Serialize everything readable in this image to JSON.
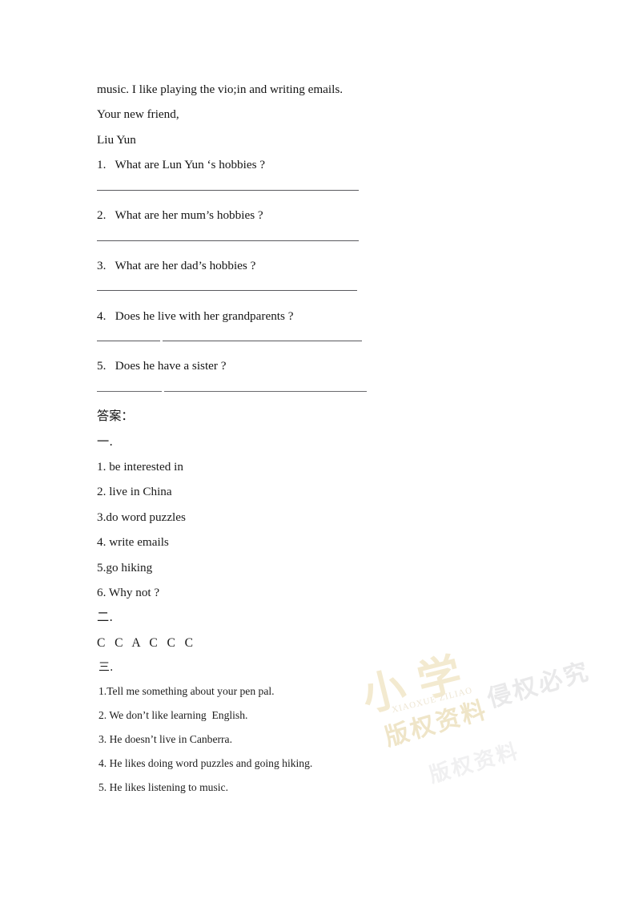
{
  "document": {
    "letter": {
      "closing_body": "music. I like playing the vio;in and writing emails.",
      "sign_off": "Your new friend,",
      "signature": "Liu Yun"
    },
    "questions": [
      {
        "text": "1.   What are Lun Yun ‘s hobbies ?"
      },
      {
        "text": "2.   What are her mum’s hobbies ?"
      },
      {
        "text": "3.   What are her dad’s hobbies ?"
      },
      {
        "text": "4.   Does he live with her grandparents ?"
      },
      {
        "text": "5.   Does he have a sister ?"
      }
    ],
    "answer_key": {
      "heading": "答案：",
      "section_one": {
        "label": "一.",
        "items": [
          "1. be interested in",
          "2. live in China",
          "3.do word puzzles",
          "4. write emails",
          "5.go hiking",
          "6. Why not ?"
        ]
      },
      "section_two": {
        "label": "二.",
        "choices": "C   C   A   C   C   C"
      },
      "section_three": {
        "label": "三.",
        "items": [
          "1.Tell me something about your pen pal.",
          "2. We don’t like learning  English.",
          "3. He doesn’t live in Canberra.",
          "4. He likes doing word puzzles and going hiking.",
          "5. He likes listening to music."
        ]
      }
    }
  },
  "watermark": {
    "logo": "小  学",
    "subtitle": "XIAOXUE  ZILIAO",
    "text_one": "版权资料",
    "text_two": "侵权必究",
    "colors": {
      "gold": "#efe5c8",
      "gray": "#e9e9ea"
    }
  }
}
